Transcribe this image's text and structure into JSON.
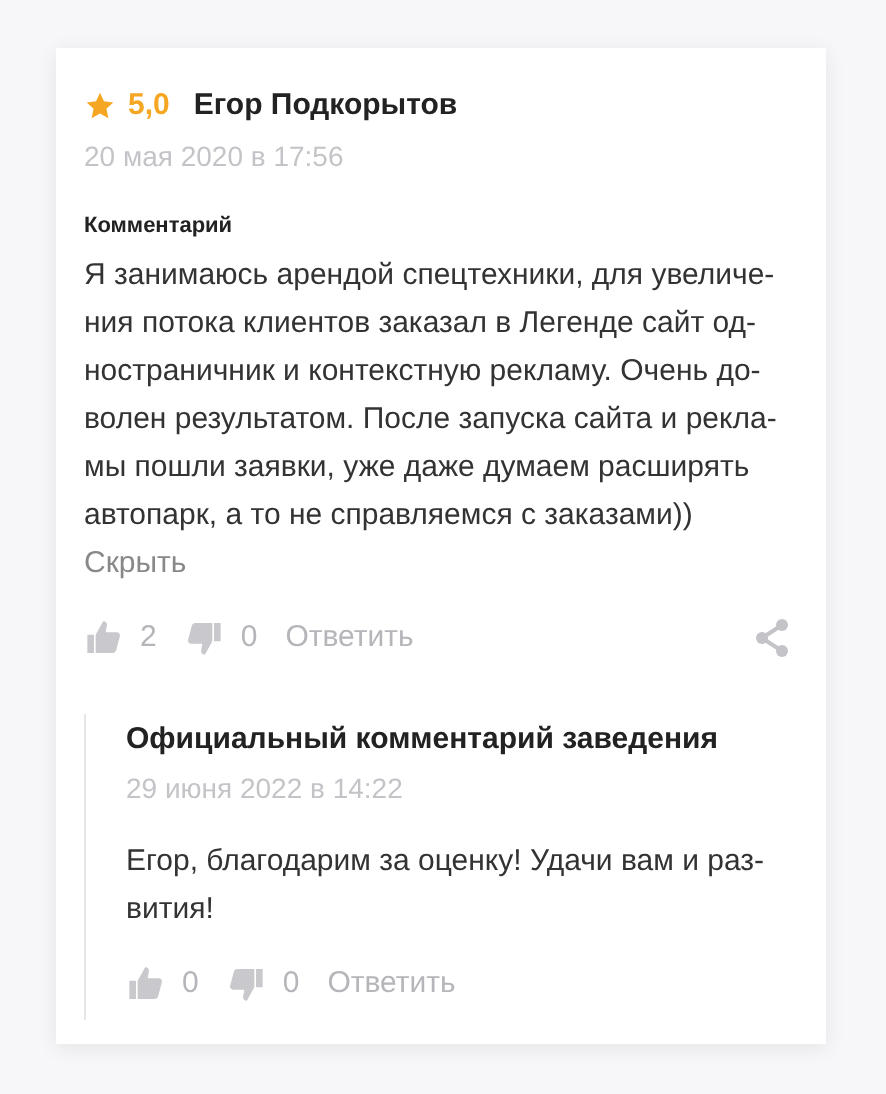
{
  "review": {
    "rating": "5,0",
    "author": "Егор Подкорытов",
    "date": "20 мая 2020 в 17:56",
    "section_label": "Комментарий",
    "text_lines": [
      "Я занимаюсь арендой спецтехники, для увеличе-",
      "ния потока клиентов заказал в Легенде сайт од-",
      "ностраничник и контекстную рекламу. Очень до-",
      "волен результатом. После запуска сайта и рекла-",
      "мы пошли заявки, уже даже думаем расширять",
      "автопарк, а то не справляемся с заказами))"
    ],
    "collapse_link": "Скрыть",
    "likes": "2",
    "dislikes": "0",
    "reply_label": "Ответить"
  },
  "official_reply": {
    "title": "Официальный комментарий заведения",
    "date": "29 июня 2022 в 14:22",
    "text_lines": [
      "Егор, благодарим за оценку! Удачи вам и раз-",
      "вития!"
    ],
    "likes": "0",
    "dislikes": "0",
    "reply_label": "Ответить"
  }
}
